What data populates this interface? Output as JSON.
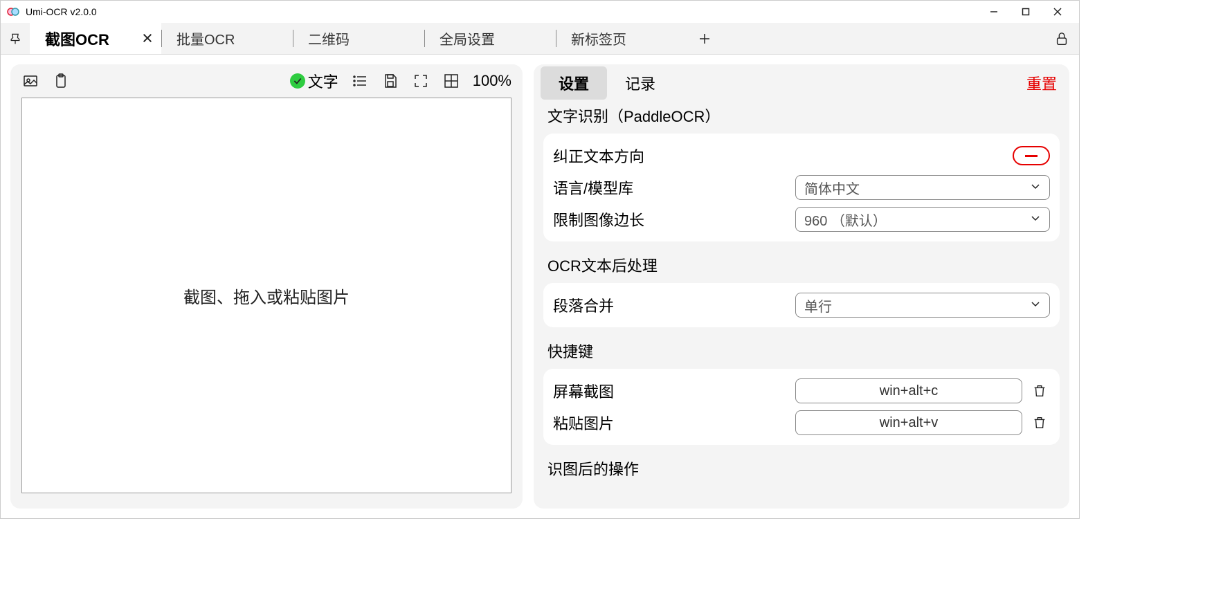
{
  "window": {
    "title": "Umi-OCR v2.0.0"
  },
  "tabs": [
    {
      "label": "截图OCR",
      "active": true
    },
    {
      "label": "批量OCR"
    },
    {
      "label": "二维码"
    },
    {
      "label": "全局设置"
    },
    {
      "label": "新标签页"
    }
  ],
  "left_toolbar": {
    "text_label": "文字",
    "zoom": "100%"
  },
  "drop_area": {
    "hint": "截图、拖入或粘贴图片"
  },
  "right": {
    "tab_settings": "设置",
    "tab_history": "记录",
    "reset": "重置",
    "sections": {
      "ocr_engine": {
        "title": "文字识别（PaddleOCR）",
        "orient_label": "纠正文本方向",
        "lang_label": "语言/模型库",
        "lang_value": "简体中文",
        "limit_label": "限制图像边长",
        "limit_value": "960 （默认）"
      },
      "postproc": {
        "title": "OCR文本后处理",
        "merge_label": "段落合并",
        "merge_value": "单行"
      },
      "hotkeys": {
        "title": "快捷键",
        "screenshot_label": "屏幕截图",
        "screenshot_value": "win+alt+c",
        "paste_label": "粘贴图片",
        "paste_value": "win+alt+v"
      },
      "after": {
        "title": "识图后的操作"
      }
    }
  }
}
